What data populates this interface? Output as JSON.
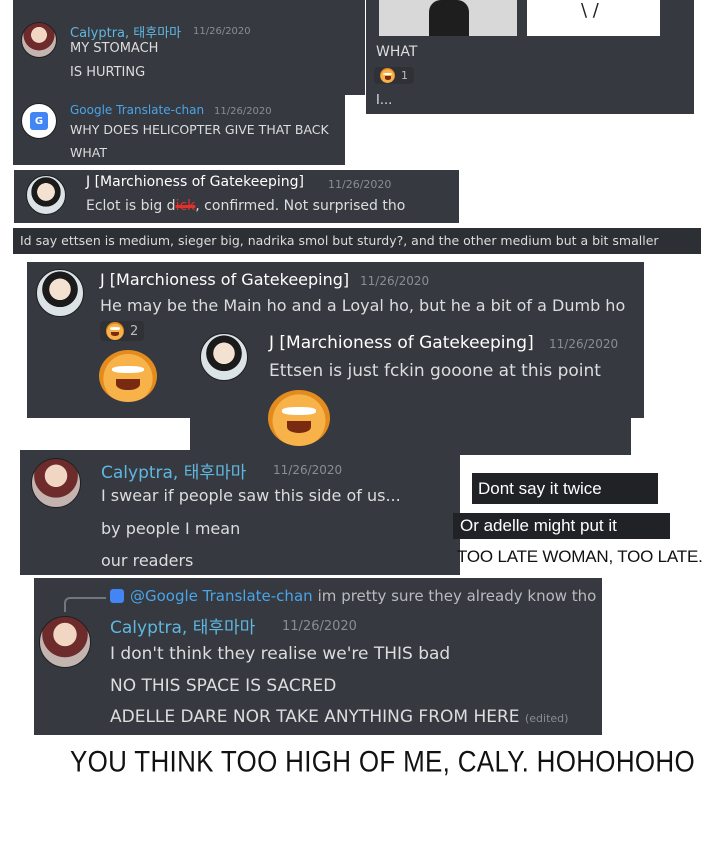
{
  "top_left": {
    "cal_name": "Calyptra, 태후마마",
    "cal_time": "11/26/2020",
    "cal_line1": "MY STOMACH",
    "cal_line2": "IS HURTING",
    "gt_name": "Google Translate-chan",
    "gt_time": "11/26/2020",
    "gt_line1": "WHY DOES HELICOPTER GIVE THAT BACK",
    "gt_line2": "WHAT"
  },
  "top_right": {
    "line1": "WHAT",
    "reaction_count": "1",
    "line2": "I..."
  },
  "j_msg1": {
    "name": "J [Marchioness of Gatekeeping]",
    "time": "11/26/2020",
    "text_before": "Eclot is big d",
    "text_redacted": "ick",
    "text_after": ", confirmed. Not surprised tho"
  },
  "banner": {
    "text": "Id say ettsen is medium, sieger big, nadrika smol but sturdy?, and the other medium but a bit smaller"
  },
  "j_msg2": {
    "name": "J [Marchioness of Gatekeeping]",
    "time": "11/26/2020",
    "text": "He may be the Main ho and a Loyal ho, but he a bit of a Dumb ho",
    "reaction_count": "2"
  },
  "j_msg3": {
    "name": "J [Marchioness of Gatekeeping]",
    "time": "11/26/2020",
    "text": "Ettsen is just fckin gooone at this point"
  },
  "cal_msg2": {
    "name": "Calyptra, 태후마마",
    "time": "11/26/2020",
    "line1": "I swear if people saw this side of us...",
    "line2": "by people I mean",
    "line3": "our readers"
  },
  "side_notes": {
    "note1": "Dont say  it twice",
    "note2": "Or adelle might put it",
    "note3": "TOO LATE WOMAN, TOO LATE."
  },
  "cal_msg3": {
    "reply_mention": "@Google Translate-chan",
    "reply_text": "im pretty sure they already know tho",
    "name": "Calyptra, 태후마마",
    "time": "11/26/2020",
    "line1": "I don't think they realise we're THIS bad",
    "line2": "NO THIS SPACE IS SACRED",
    "line3": "ADELLE DARE NOR TAKE ANYTHING FROM HERE",
    "edited": "(edited)"
  },
  "caption": {
    "text": "YOU THINK TOO HIGH OF ME, CALY. HOHOHOHO"
  },
  "colors": {
    "panel_bg": "#36393f",
    "name_blue": "#5fb7e0",
    "text": "#dcddde",
    "timestamp": "#8a8d93"
  }
}
